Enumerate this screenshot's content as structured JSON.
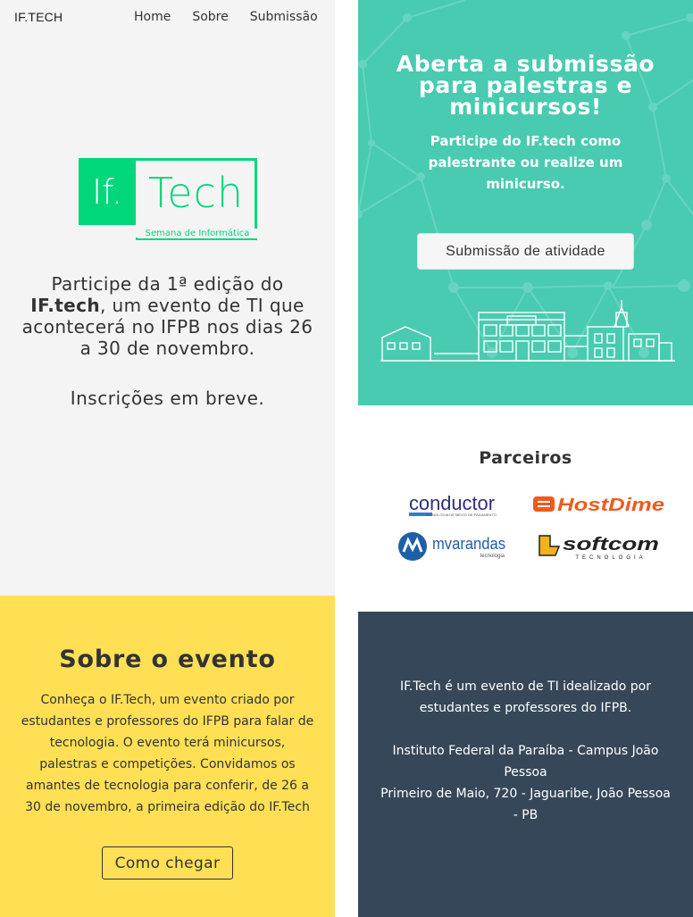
{
  "nav": {
    "brand": "IF.TECH",
    "links": [
      "Home",
      "Sobre",
      "Submissão"
    ]
  },
  "logo": {
    "if_text": "If.",
    "tech_text": "Tech",
    "subtitle": "Semana de Informática"
  },
  "intro": {
    "line1": "Participe da 1ª edição do",
    "event_name": "IF.tech",
    "line2": ", um evento de TI que acontecerá no IFPB nos dias 26 a 30 de novembro.",
    "inscricoes": "Inscrições em breve."
  },
  "hero": {
    "title": "Aberta a submissão para palestras e minicursos!",
    "subtitle": "Participe do IF.tech como palestrante ou realize um minicurso.",
    "button": "Submissão de atividade"
  },
  "parceiros": {
    "title": "Parceiros",
    "logos": [
      {
        "name": "conductor",
        "tagline": "TECNOLOGIA DE MEIOS DE PAGAMENTO"
      },
      {
        "name": "HostDime"
      },
      {
        "name": "mvarandas",
        "tagline": "tecnologia"
      },
      {
        "name": "softcom",
        "tagline": "TECNOLOGIA"
      }
    ]
  },
  "sobre": {
    "title": "Sobre o evento",
    "text": "Conheça o IF.Tech, um evento criado por estudantes e professores do IFPB para falar de tecnologia. O evento terá minicursos, palestras e competições. Convidamos os amantes de tecnologia para conferir, de 26 a 30 de novembro, a primeira edição do IF.Tech",
    "button": "Como chegar"
  },
  "info": {
    "about": "IF.Tech é um evento de TI idealizado por estudantes e professores do IFPB.",
    "institution": "Instituto Federal da Paraíba - Campus João Pessoa",
    "address": "Primeiro de Maio, 720 - Jaguaribe, João Pessoa - PB"
  },
  "colors": {
    "hero_bg": "#48cbb1",
    "logo_green": "#00d77a",
    "sobre_bg": "#ffe055",
    "info_bg": "#36475a",
    "left_bg": "#f4f4f4"
  }
}
